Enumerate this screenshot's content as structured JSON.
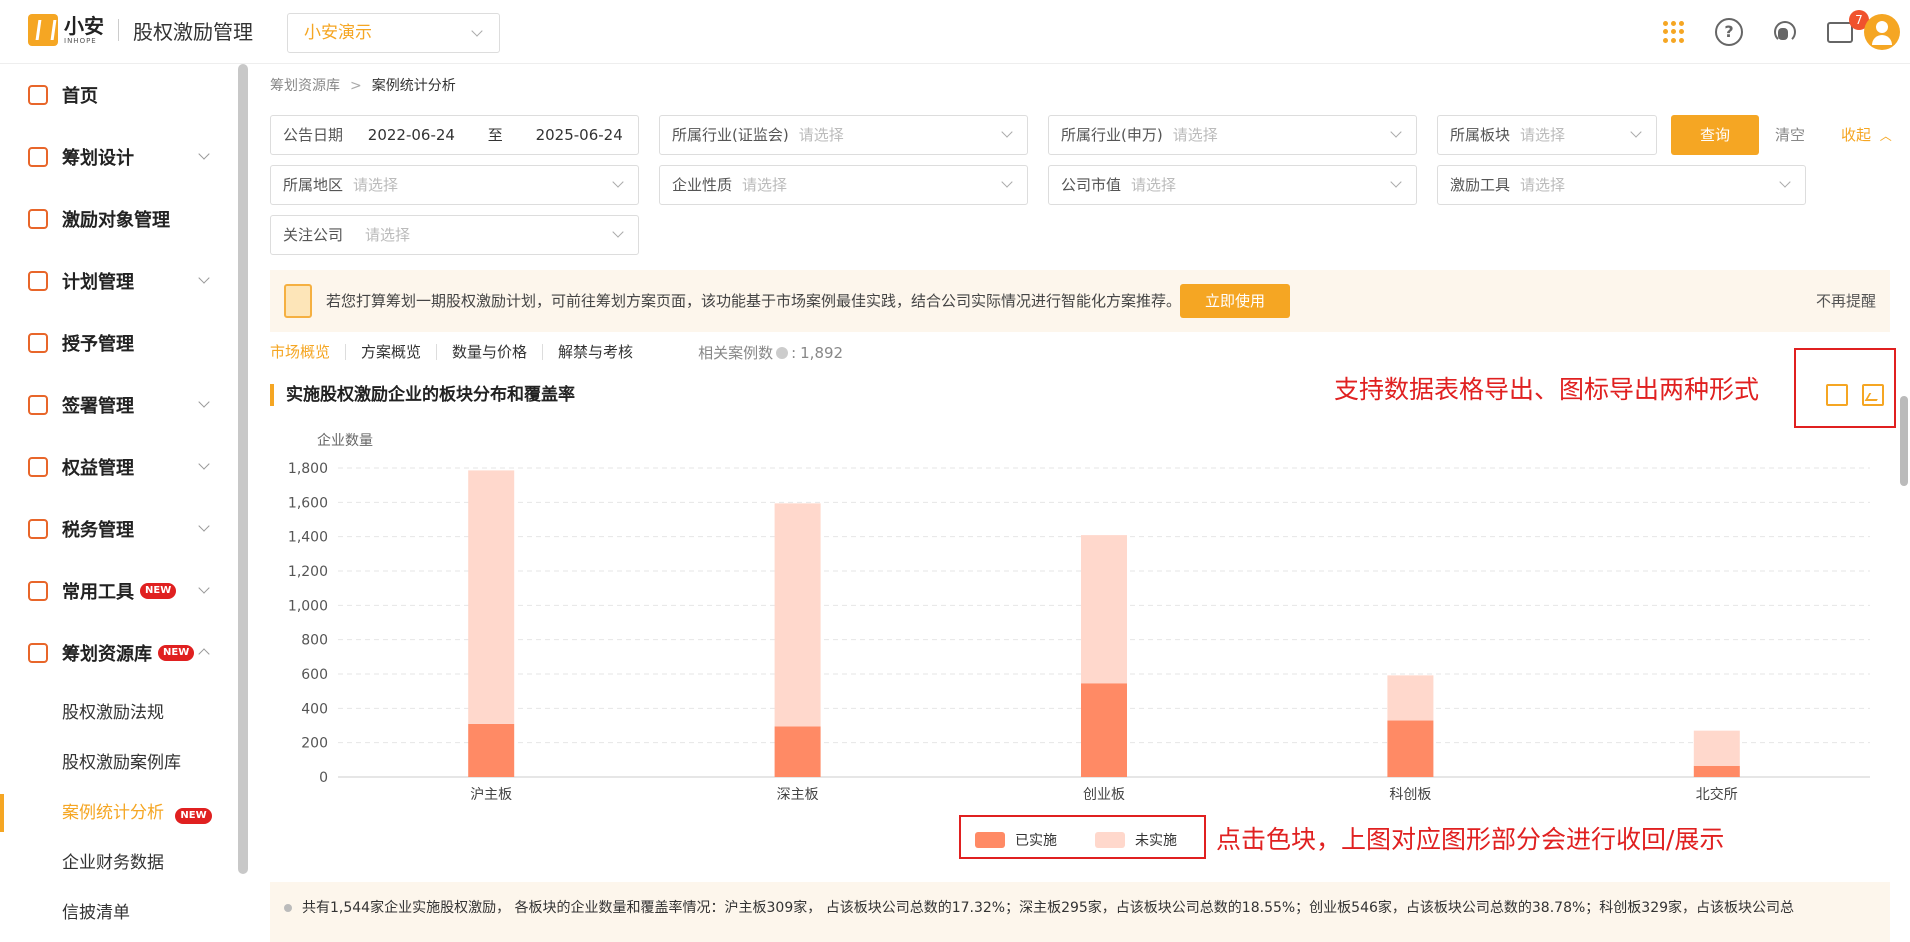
{
  "header": {
    "logo_name": "小安",
    "logo_sub": "INHOPE",
    "app_title": "股权激励管理",
    "company": "小安演示",
    "msg_count": "7",
    "icons": [
      "apps-grid-icon",
      "help-icon",
      "support-headset-icon",
      "message-icon",
      "user-avatar-icon"
    ]
  },
  "sidebar": {
    "items": [
      {
        "label": "首页",
        "icon": "home-icon"
      },
      {
        "label": "筹划设计",
        "icon": "design-icon"
      },
      {
        "label": "激励对象管理",
        "icon": "users-icon"
      },
      {
        "label": "计划管理",
        "icon": "plan-icon"
      },
      {
        "label": "授予管理",
        "icon": "grant-icon"
      },
      {
        "label": "签署管理",
        "icon": "sign-icon"
      },
      {
        "label": "权益管理",
        "icon": "equity-icon"
      },
      {
        "label": "税务管理",
        "icon": "tax-icon"
      },
      {
        "label": "常用工具",
        "icon": "toolbox-icon",
        "badge": "NEW"
      },
      {
        "label": "筹划资源库",
        "icon": "layers-icon",
        "badge": "NEW"
      }
    ],
    "sub_items": [
      {
        "label": "股权激励法规"
      },
      {
        "label": "股权激励案例库"
      },
      {
        "label": "案例统计分析",
        "badge": "NEW"
      },
      {
        "label": "企业财务数据"
      },
      {
        "label": "信披清单"
      }
    ]
  },
  "breadcrumb": {
    "parent": "筹划资源库",
    "current": "案例统计分析"
  },
  "filters": {
    "date_label": "公告日期",
    "date_from": "2022-06-24",
    "date_to_sep": "至",
    "date_to": "2025-06-24",
    "industry_csrc": "所属行业(证监会)",
    "industry_sw": "所属行业(申万)",
    "board": "所属板块",
    "region": "所属地区",
    "nature": "企业性质",
    "market_cap": "公司市值",
    "tool": "激励工具",
    "focus": "关注公司",
    "placeholder": "请选择",
    "query": "查询",
    "clear": "清空",
    "collapse": "收起"
  },
  "tip": {
    "text": "若您打算筹划一期股权激励计划，可前往筹划方案页面，该功能基于市场案例最佳实践，结合公司实际情况进行智能化方案推荐。",
    "button": "立即使用",
    "dismiss": "不再提醒"
  },
  "tabs": {
    "items": [
      "市场概览",
      "方案概览",
      "数量与价格",
      "解禁与考核"
    ],
    "case_label": "相关案例数",
    "case_value": "1,892"
  },
  "section_title": "实施股权激励企业的板块分布和覆盖率",
  "annotations": {
    "export": "支持数据表格导出、图标导出两种形式",
    "legend": "点击色块，上图对应图形部分会进行收回/展示"
  },
  "chart_data": {
    "type": "bar",
    "stacked": true,
    "ylabel": "企业数量",
    "ylim": [
      0,
      1800
    ],
    "yticks": [
      "0",
      "200",
      "400",
      "600",
      "800",
      "1,000",
      "1,200",
      "1,400",
      "1,600",
      "1,800"
    ],
    "categories": [
      "沪主板",
      "深主板",
      "创业板",
      "科创板",
      "北交所"
    ],
    "series": [
      {
        "name": "已实施",
        "color": "#ff8a65",
        "values": [
          309,
          295,
          546,
          329,
          65
        ]
      },
      {
        "name": "未实施",
        "color": "#ffd8cc",
        "values": [
          1477,
          1299,
          863,
          263,
          205
        ]
      }
    ],
    "grid": true,
    "legend": "bottom"
  },
  "summary": "共有1,544家企业实施股权激励， 各板块的企业数量和覆盖率情况：沪主板309家， 占该板块公司总数的17.32%；深主板295家，占该板块公司总数的18.55%；创业板546家，占该板块公司总数的38.78%；科创板329家，占该板块公司总"
}
